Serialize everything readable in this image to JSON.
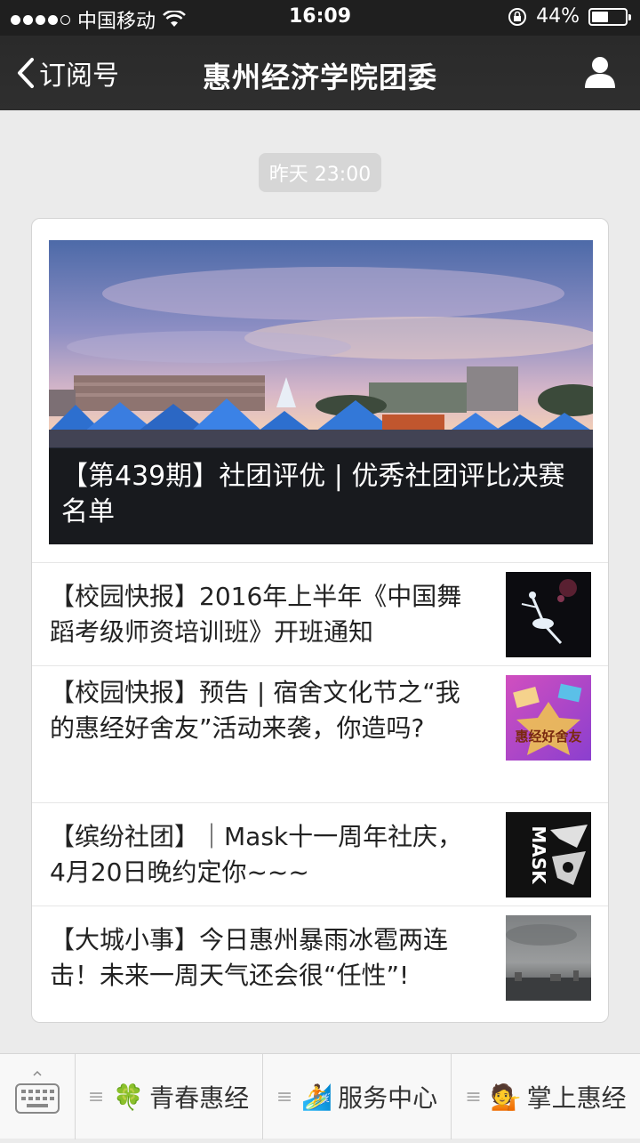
{
  "status_bar": {
    "carrier": "中国移动",
    "time": "16:09",
    "battery_percent": "44%",
    "battery_level": 0.44
  },
  "nav": {
    "back_label": "订阅号",
    "title": "惠州经济学院团委"
  },
  "timestamp": "昨天 23:00",
  "cover": {
    "title": "【第439期】社团评优 | 优秀社团评比决赛名单"
  },
  "articles": [
    {
      "title": "【校园快报】2016年上半年《中国舞蹈考级师资培训班》开班通知",
      "thumb": "dance-thumbnail"
    },
    {
      "title": "【校园快报】预告 | 宿舍文化节之“我的惠经好舍友”活动来袭，你造吗?",
      "thumb": "dorm-thumbnail",
      "thumb_text": "惠经好舍友"
    },
    {
      "title": "【缤纷社团】｜Mask十一周年社庆，4月20日晚约定你~~~",
      "thumb": "mask-thumbnail",
      "thumb_text": "MASK"
    },
    {
      "title": "【大城小事】今日惠州暴雨冰雹两连击！未来一周天气还会很“任性”!",
      "thumb": "weather-thumbnail"
    }
  ],
  "menu": [
    {
      "label": "青春惠经",
      "icon": "clover-icon",
      "emoji": "🍀"
    },
    {
      "label": "服务中心",
      "icon": "surfer-icon",
      "emoji": "🏄"
    },
    {
      "label": "掌上惠经",
      "icon": "person-icon",
      "emoji": "💁"
    }
  ]
}
